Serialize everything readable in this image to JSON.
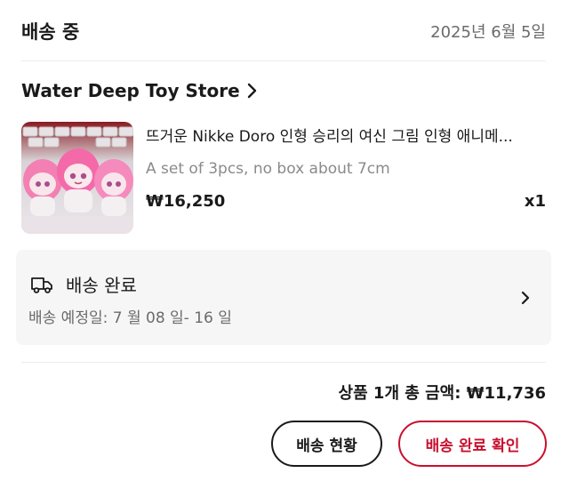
{
  "header": {
    "status_title": "배송 중",
    "order_date": "2025년 6월 5일"
  },
  "store": {
    "name": "Water Deep Toy Store",
    "chevron_icon": "chevron-right-icon"
  },
  "product": {
    "title": "뜨거운 Nikke Doro 인형 승리의 여신 그림 인형 애니메...",
    "variant": "A set of 3pcs, no box about 7cm",
    "price": "₩16,250",
    "quantity": "x1",
    "thumbnail_icon": "pink-doll-figures-image"
  },
  "delivery": {
    "icon": "truck-icon",
    "status": "배송 완료",
    "estimate": "배송 예정일: 7 월 08 일- 16 일",
    "chevron_icon": "chevron-right-icon"
  },
  "summary": {
    "total_text": "상품 1개 총 금액: ₩11,736"
  },
  "actions": {
    "delivery_status_label": "배송 현황",
    "confirm_delivery_label": "배송 완료 확인"
  },
  "colors": {
    "accent_red": "#c8102e",
    "text_primary": "#1a1a1a",
    "text_secondary": "#6b6b6b",
    "card_bg": "#f6f6f6"
  }
}
